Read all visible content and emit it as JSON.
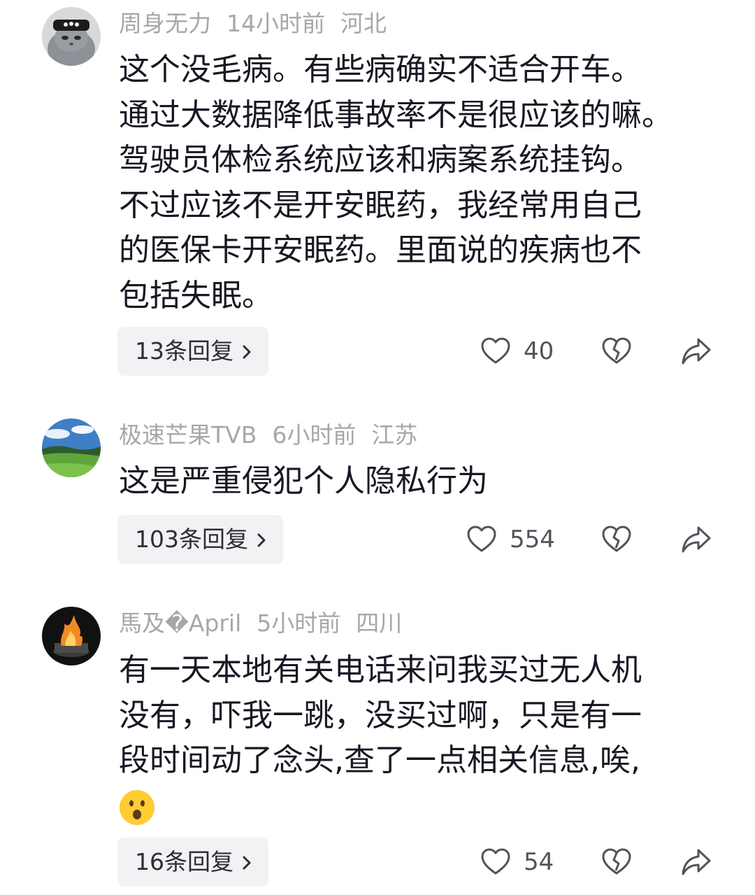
{
  "comments": [
    {
      "author": "周身无力",
      "time": "14小时前",
      "location": "河北",
      "lines": [
        "这个没毛病。有些病确实不适合开车。",
        "通过大数据降低事故率不是很应该的嘛。",
        "驾驶员体检系统应该和病案系统挂钩。",
        "不过应该不是开安眠药，我经常用自己",
        "的医保卡开安眠药。里面说的疾病也不",
        "包括失眠。"
      ],
      "replies": "13条回复",
      "likes": "40",
      "avatar_icon": "cat-avatar-icon"
    },
    {
      "author": "极速芒果TVB",
      "time": "6小时前",
      "location": "江苏",
      "lines": [
        "这是严重侵犯个人隐私行为"
      ],
      "replies": "103条回复",
      "likes": "554",
      "avatar_icon": "landscape-avatar-icon"
    },
    {
      "author": "馬及�April",
      "time": "5小时前",
      "location": "四川",
      "lines": [
        "有一天本地有关电话来问我买过无人机",
        "没有，吓我一跳，没买过啊，只是有一",
        "段时间动了念头,查了一点相关信息,唉,"
      ],
      "emoji": "surprised-face-emoji",
      "replies": "16条回复",
      "likes": "54",
      "avatar_icon": "fire-avatar-icon"
    }
  ],
  "colors": {
    "meta": "#a7a7ab",
    "text": "#161823",
    "reply_bg": "#f2f2f4",
    "icon": "#52525b"
  }
}
